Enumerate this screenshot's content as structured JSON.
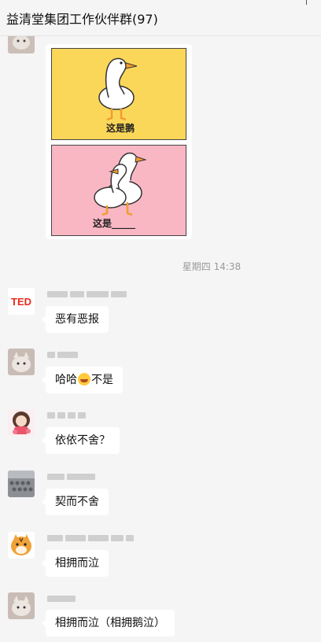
{
  "header": {
    "title": "益清堂集团工作伙伴群(97)"
  },
  "meme": {
    "caption_top": "这是鹅",
    "caption_bottom": "这是_____"
  },
  "timestamp": "星期四 14:38",
  "messages": [
    {
      "avatar": "ted-logo-avatar",
      "avatar_text": "TED",
      "text": "恶有恶报"
    },
    {
      "avatar": "cat-avatar",
      "text_before": "哈哈",
      "emoji": "laughing-emoji",
      "text_after": "不是"
    },
    {
      "avatar": "girl-avatar",
      "text": "依依不舍？"
    },
    {
      "avatar": "crowd-photo-avatar",
      "text": "契而不舍"
    },
    {
      "avatar": "tiger-avatar",
      "text": "相拥而泣"
    },
    {
      "avatar": "cat-avatar-2",
      "text": "相拥而泣（相拥鹅泣）"
    }
  ],
  "colors": {
    "background": "#f5f5f5",
    "bubble": "#ffffff",
    "ted_red": "#e62b1e"
  }
}
